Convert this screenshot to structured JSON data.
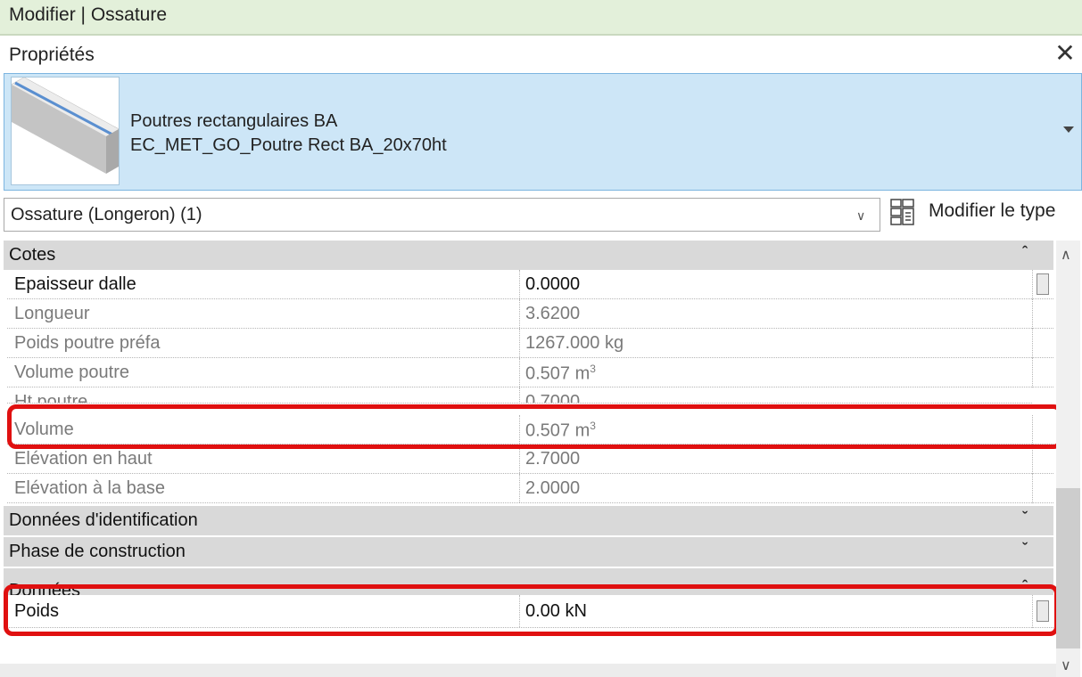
{
  "ribbon": {
    "context_title": "Modifier | Ossature"
  },
  "panel": {
    "title": "Propriétés",
    "close_glyph": "✕"
  },
  "type_selector": {
    "family": "Poutres rectangulaires BA",
    "type_name": "EC_MET_GO_Poutre Rect BA_20x70ht",
    "thumbnail_icon": "beam-thumbnail"
  },
  "instance_filter": {
    "label": "Ossature (Longeron) (1)"
  },
  "edit_type": {
    "label": "Modifier le type",
    "icon": "edit-type-icon"
  },
  "sections": [
    {
      "label": "Cotes",
      "expanded": true,
      "rows": [
        {
          "name": "Epaisseur dalle",
          "value": "0.0000",
          "editable": true
        },
        {
          "name": "Longueur",
          "value": "3.6200",
          "editable": false
        },
        {
          "name": "Poids poutre préfa",
          "value": "1267.000 kg",
          "editable": false
        },
        {
          "name": "Volume poutre",
          "value": "0.507 m",
          "unit_sup": "3",
          "editable": false
        },
        {
          "name": "Ht poutre",
          "value": "0.7000",
          "editable": false
        },
        {
          "name": "Volume",
          "value": "0.507 m",
          "unit_sup": "3",
          "editable": false
        },
        {
          "name": "Elévation en haut",
          "value": "2.7000",
          "editable": false
        },
        {
          "name": "Elévation à la base",
          "value": "2.0000",
          "editable": false
        }
      ]
    },
    {
      "label": "Données d'identification",
      "expanded": false,
      "rows": []
    },
    {
      "label": "Phase de construction",
      "expanded": false,
      "rows": []
    },
    {
      "label": "Données",
      "expanded": true,
      "rows": [
        {
          "name": "Poids",
          "value": "0.00 kN",
          "editable": true
        }
      ]
    }
  ],
  "highlight_color": "#e01010"
}
